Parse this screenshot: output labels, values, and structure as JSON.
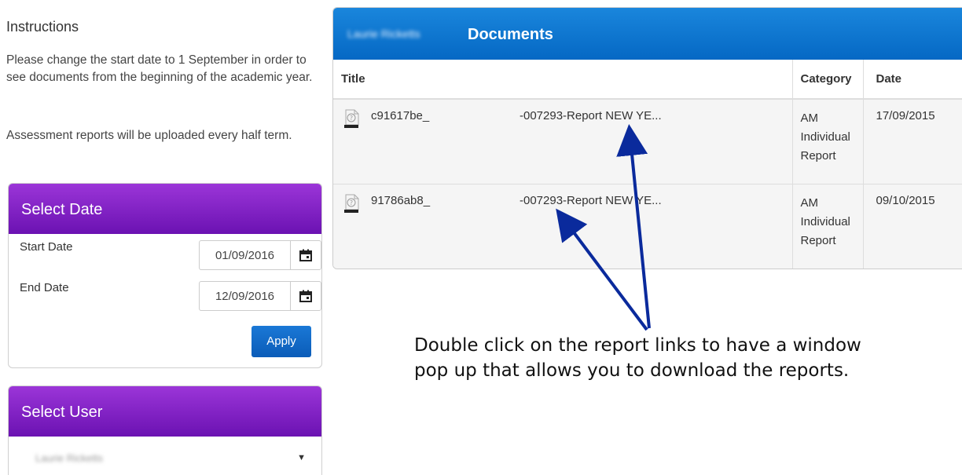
{
  "instructions": {
    "title": "Instructions",
    "paragraph1": "Please change the start date to 1 September in order to see documents from the beginning of the academic year.",
    "paragraph2": "Assessment reports will be uploaded every half term."
  },
  "select_date": {
    "title": "Select Date",
    "start_label": "Start Date",
    "start_value": "01/09/2016",
    "end_label": "End Date",
    "end_value": "12/09/2016",
    "apply_label": "Apply"
  },
  "select_user": {
    "title": "Select User",
    "selected_value": "Laurie Ricketts"
  },
  "documents": {
    "owner_name": "Laurie Ricketts",
    "title": "Documents",
    "columns": [
      "Title",
      "Category",
      "Date"
    ],
    "rows": [
      {
        "file_id": "c91617be_",
        "report_name": "-007293-Report NEW YE...",
        "category": [
          "AM",
          "Individual",
          "Report"
        ],
        "date": "17/09/2015"
      },
      {
        "file_id": "91786ab8_",
        "report_name": "-007293-Report NEW YE...",
        "category": [
          "AM",
          "Individual",
          "Report"
        ],
        "date": "09/10/2015"
      }
    ]
  },
  "annotation": {
    "line1": "Double click on the report links to have a window",
    "line2": "pop up that allows you to download the reports.",
    "arrow_color": "#0a2a9c"
  },
  "colors": {
    "purple_header": "#7a1fc2",
    "blue_header": "#0d72cf",
    "apply_button": "#1167c7"
  }
}
